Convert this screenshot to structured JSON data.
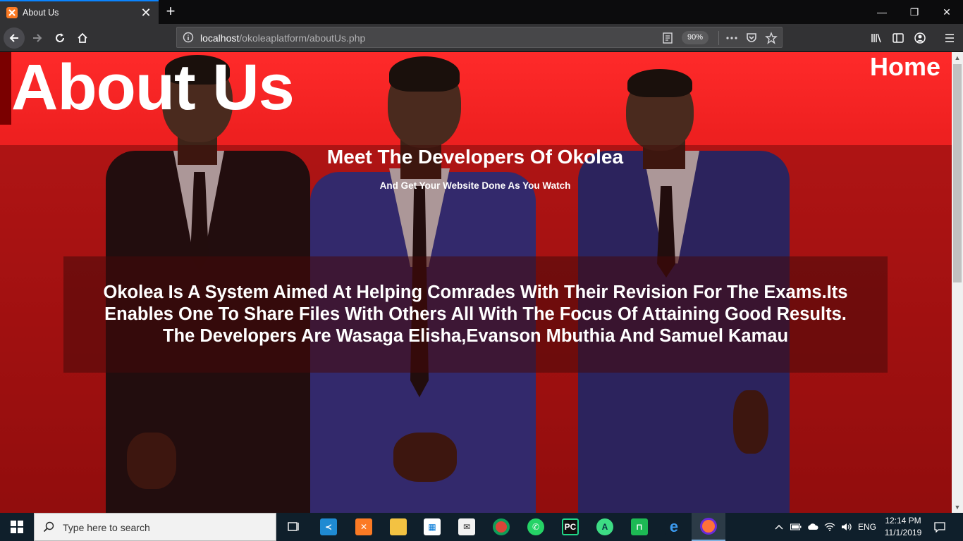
{
  "browser": {
    "tab_title": "About Us",
    "tab_close": "✕",
    "new_tab": "+",
    "url_host": "localhost",
    "url_path": "/okoleaplatform/aboutUs.php",
    "zoom": "90%",
    "window_controls": {
      "minimize": "—",
      "restore": "❐",
      "close": "✕"
    }
  },
  "page": {
    "title": "About Us",
    "home_link": "Home",
    "heading": "Meet The Developers Of Okolea",
    "subheading": "And Get Your Website Done As You Watch",
    "about_lines": [
      "Okolea Is A System Aimed At Helping Comrades With Their Revision For The Exams.Its",
      "Enables One To Share Files With Others All With The Focus Of Attaining Good Results.",
      "The Developers Are Wasaga Elisha,Evanson Mbuthia And Samuel Kamau"
    ]
  },
  "taskbar": {
    "search_placeholder": "Type here to search",
    "language": "ENG",
    "time": "12:14 PM",
    "date": "11/1/2019",
    "pinned_apps": [
      "task-view",
      "visual-studio-code",
      "xampp",
      "file-explorer",
      "microsoft-store",
      "mail",
      "chrome",
      "whatsapp",
      "pycharm",
      "android-studio",
      "app-green",
      "edge",
      "firefox"
    ]
  },
  "colors": {
    "page_red": "#ee2020",
    "tab_accent": "#0a84ff",
    "taskbar": "#0f1f2b"
  }
}
